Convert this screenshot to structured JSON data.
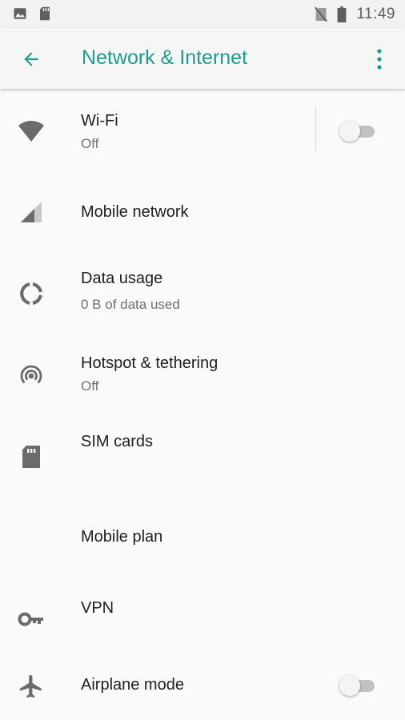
{
  "status_bar": {
    "time": "11:49",
    "left_icons": [
      "image-icon",
      "sd-card-icon"
    ],
    "right_icons": [
      "no-sim-icon",
      "battery-icon"
    ]
  },
  "app_bar": {
    "title": "Network & Internet",
    "back_icon": "arrow-left-icon",
    "menu_icon": "more-vert-icon",
    "accent_color": "#1c9e8b"
  },
  "items": [
    {
      "key": "wifi",
      "title": "Wi-Fi",
      "subtitle": "Off",
      "icon": "wifi-icon",
      "toggle": true,
      "toggle_on": false
    },
    {
      "key": "mobile-network",
      "title": "Mobile network",
      "subtitle": "",
      "icon": "signal-icon"
    },
    {
      "key": "data-usage",
      "title": "Data usage",
      "subtitle": "0 B of data used",
      "icon": "data-usage-icon"
    },
    {
      "key": "hotspot",
      "title": "Hotspot & tethering",
      "subtitle": "Off",
      "icon": "hotspot-icon"
    },
    {
      "key": "sim-cards",
      "title": "SIM cards",
      "subtitle": "",
      "icon": "sim-card-icon"
    },
    {
      "key": "mobile-plan",
      "title": "Mobile plan",
      "subtitle": ""
    },
    {
      "key": "vpn",
      "title": "VPN",
      "subtitle": "",
      "icon": "vpn-key-icon"
    },
    {
      "key": "airplane",
      "title": "Airplane mode",
      "subtitle": "",
      "icon": "airplane-icon",
      "toggle": true,
      "toggle_on": false
    }
  ]
}
